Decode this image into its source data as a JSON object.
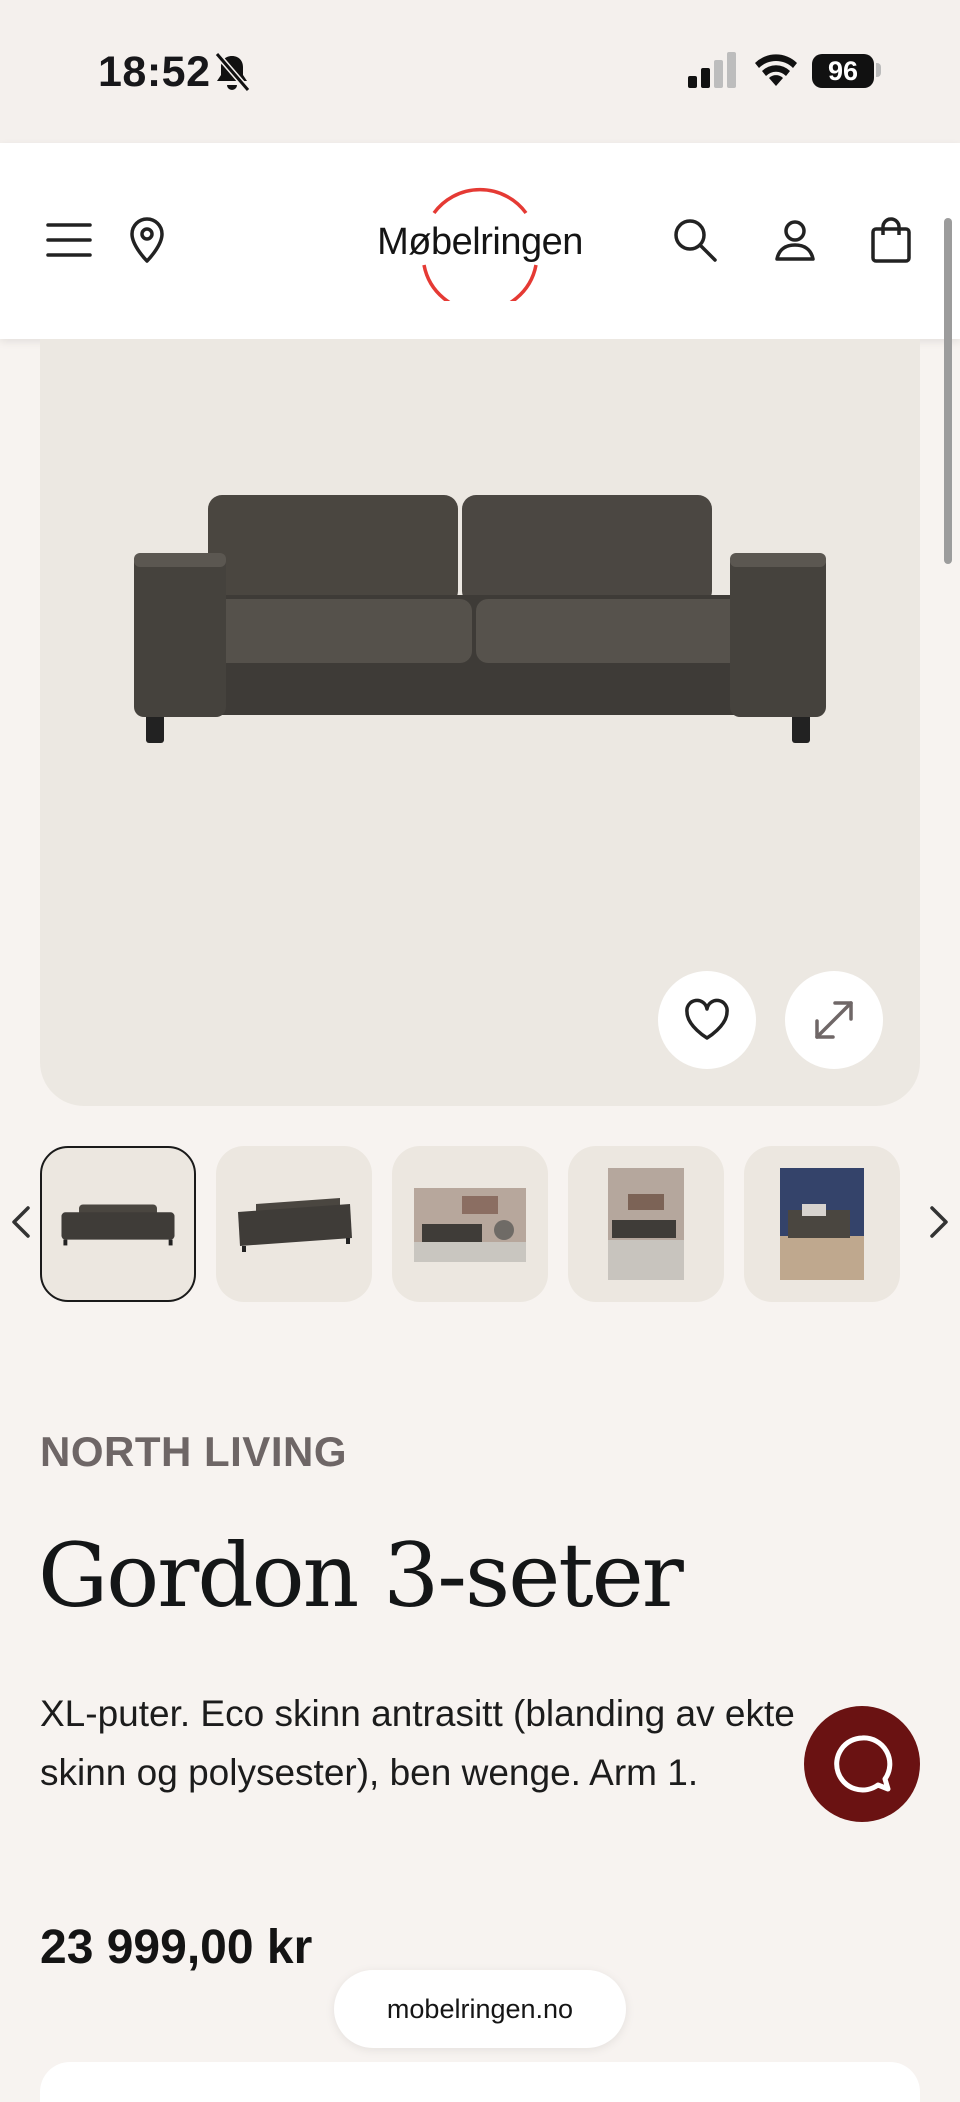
{
  "status_bar": {
    "time": "18:52",
    "battery": "96"
  },
  "header": {
    "logo_text": "Møbelringen",
    "logo_ring_color": "#e53a34"
  },
  "gallery": {
    "thumbnail_count": 5,
    "active_index": 0
  },
  "product": {
    "brand": "NORTH LIVING",
    "title": "Gordon 3-seter",
    "description": "XL-puter. Eco skinn antrasitt (blanding av ekte skinn og polysester), ben wenge. Arm 1.",
    "price": "23 999,00 kr"
  },
  "browser": {
    "url": "mobelringen.no"
  },
  "colors": {
    "background": "#f7f3f0",
    "hero_background": "#ece8e2",
    "chat_button": "#6a1212",
    "brand_text": "#6e6666"
  }
}
